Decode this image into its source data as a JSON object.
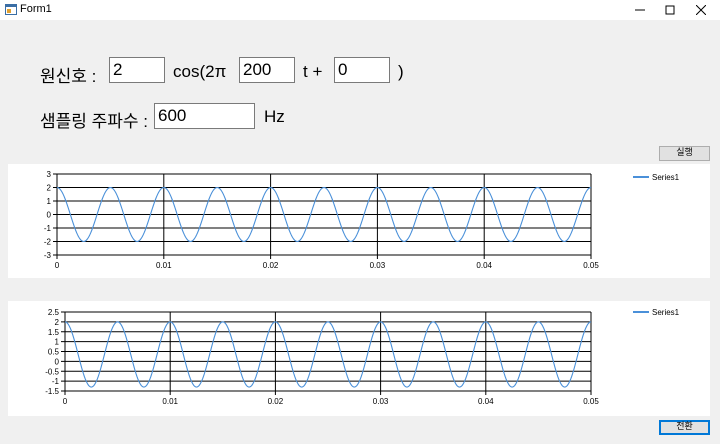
{
  "window": {
    "title": "Form1",
    "minimize_icon": "minimize-icon",
    "maximize_icon": "maximize-icon",
    "close_icon": "close-icon"
  },
  "signal": {
    "label": "원신호 :",
    "amplitude": "2",
    "cos_label": "cos(2π",
    "frequency": "200",
    "t_label": "t +",
    "phase": "0",
    "close_paren": ")"
  },
  "sampling": {
    "label": "샘플링 주파수 :",
    "value": "600",
    "unit": "Hz"
  },
  "buttons": {
    "run": "실행",
    "convert": "전환"
  },
  "chart_data": [
    {
      "type": "line",
      "series": [
        {
          "name": "Series1",
          "color": "#4a90d9"
        }
      ],
      "function": "2*cos(2*pi*200*t)",
      "x": {
        "min": 0,
        "max": 0.05,
        "ticks": [
          "0",
          "0.01",
          "0.02",
          "0.03",
          "0.04",
          "0.05"
        ]
      },
      "y": {
        "min": -3,
        "max": 3,
        "ticks": [
          "3",
          "2",
          "1",
          "0",
          "-1",
          "-2",
          "-3"
        ]
      },
      "grid": true,
      "legend": "top-right"
    },
    {
      "type": "line",
      "series": [
        {
          "name": "Series1",
          "color": "#4a90d9"
        }
      ],
      "function": "0.35+1.65*cos(2*pi*200*t)",
      "x": {
        "min": 0,
        "max": 0.05,
        "ticks": [
          "0",
          "0.01",
          "0.02",
          "0.03",
          "0.04",
          "0.05"
        ]
      },
      "y": {
        "min": -1.5,
        "max": 2.5,
        "ticks": [
          "2.5",
          "2",
          "1.5",
          "1",
          "0.5",
          "0",
          "-0.5",
          "-1",
          "-1.5"
        ]
      },
      "grid": true,
      "legend": "top-right"
    }
  ]
}
